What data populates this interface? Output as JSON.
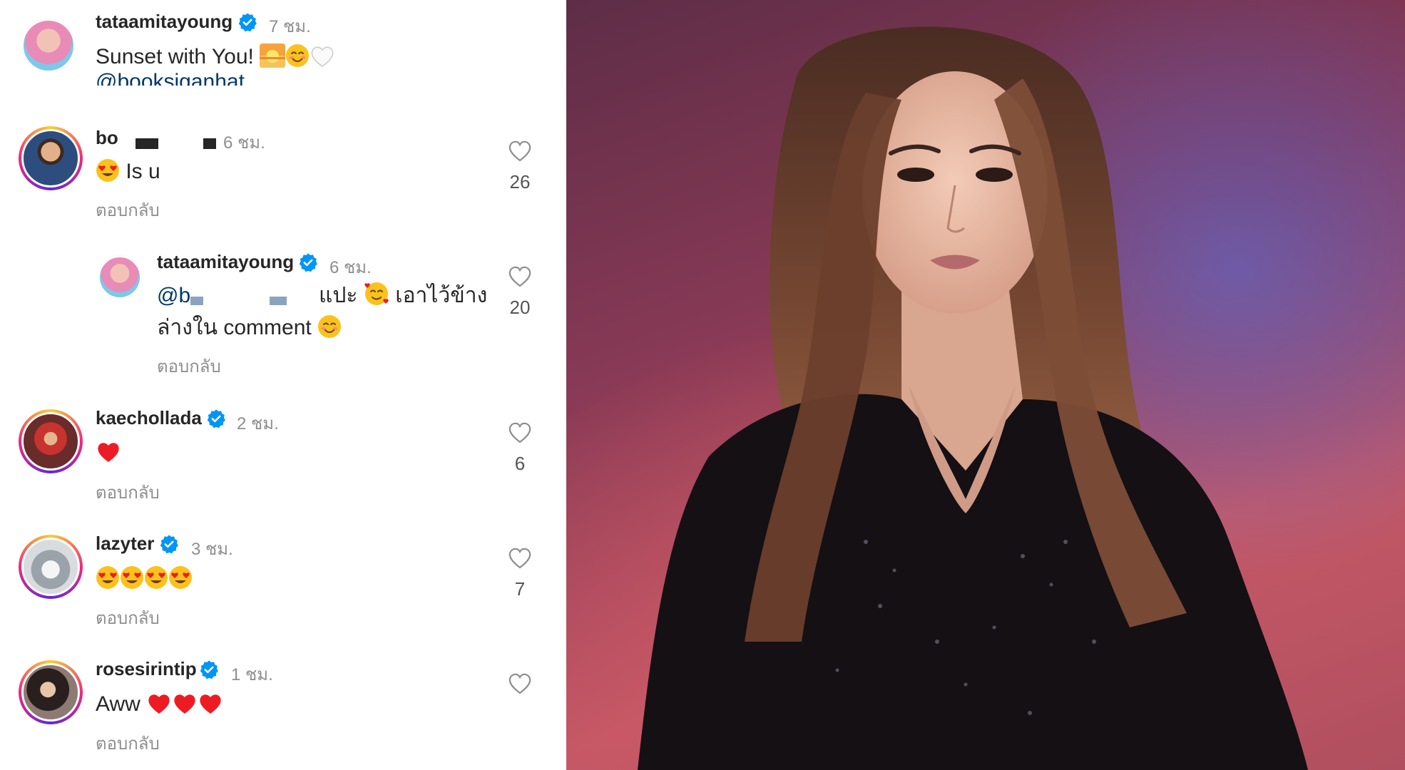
{
  "post": {
    "username": "tataamitayoung",
    "time": "7 ชม.",
    "caption": "Sunset with You!",
    "mention": "@booksiganhat"
  },
  "comments": [
    {
      "username_visible": "bo",
      "time": "6 ชม.",
      "text": "Is u",
      "reply": "ตอบกลับ",
      "likes": "26"
    },
    {
      "username": "tataamitayoung",
      "time": "6 ชม.",
      "mention_prefix": "@b",
      "text_line1_a": "แปะ",
      "text_line1_b": "เอาไว้ข้าง",
      "text_line2": "ล่างใน comment",
      "reply": "ตอบกลับ",
      "likes": "20"
    },
    {
      "username": "kaechollada",
      "time": "2 ชม.",
      "reply": "ตอบกลับ",
      "likes": "6"
    },
    {
      "username": "lazyter",
      "time": "3 ชม.",
      "reply": "ตอบกลับ",
      "likes": "7"
    },
    {
      "username": "rosesirintip",
      "time": "1 ชม.",
      "text": "Aww",
      "reply": "ตอบกลับ",
      "likes": ""
    }
  ],
  "icons": {
    "verified": "verified-badge-icon",
    "like": "heart-outline-icon",
    "heart": "red-heart-emoji",
    "heart_eyes": "heart-eyes-emoji"
  },
  "colors": {
    "text": "#262626",
    "muted": "#8e8e8e",
    "mention": "#00376b",
    "verified": "#0095f6",
    "heart": "#ed1c24"
  }
}
